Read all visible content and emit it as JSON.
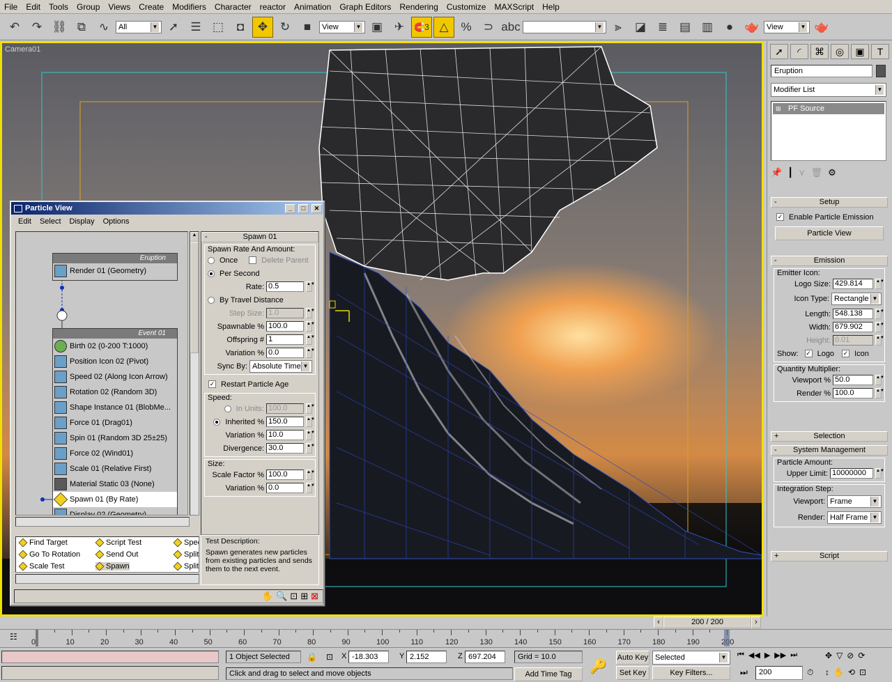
{
  "menubar": [
    "File",
    "Edit",
    "Tools",
    "Group",
    "Views",
    "Create",
    "Modifiers",
    "Character",
    "reactor",
    "Animation",
    "Graph Editors",
    "Rendering",
    "Customize",
    "MAXScript",
    "Help"
  ],
  "toolbar": {
    "selection_filter": "All",
    "ref_coord": "View",
    "named_sel": "",
    "view_dd2": "View",
    "snap_label": "3"
  },
  "viewport": {
    "label": "Camera01"
  },
  "particle_view": {
    "title": "Particle View",
    "menu": [
      "Edit",
      "Select",
      "Display",
      "Options"
    ],
    "eruption_event": {
      "title": "Eruption",
      "ops": [
        "Render 01 (Geometry)"
      ]
    },
    "event01": {
      "title": "Event 01",
      "ops": [
        "Birth 02 (0-200 T:1000)",
        "Position Icon 02 (Pivot)",
        "Speed 02 (Along Icon Arrow)",
        "Rotation 02 (Random 3D)",
        "Shape Instance 01 (BlobMe...",
        "Force 01 (Drag01)",
        "Spin 01 (Random 3D 25±25)",
        "Force 02 (Wind01)",
        "Scale 01 (Relative First)",
        "Material Static 03 (None)",
        "Spawn 01 (By Rate)",
        "Display 02 (Geometry)"
      ]
    },
    "params": {
      "rollout": "Spawn 01",
      "rate_group": "Spawn Rate And Amount:",
      "once": "Once",
      "delete_parent": "Delete Parent",
      "per_second": "Per Second",
      "rate_label": "Rate:",
      "rate": "0.5",
      "by_travel": "By Travel Distance",
      "step_label": "Step Size:",
      "step": "1.0",
      "spawnable_label": "Spawnable %",
      "spawnable": "100.0",
      "offspring_label": "Offspring #",
      "offspring": "1",
      "variation_label": "Variation %",
      "variation": "0.0",
      "sync_label": "Sync By:",
      "sync": "Absolute Time",
      "restart": "Restart Particle Age",
      "speed_group": "Speed:",
      "in_units_label": "In Units:",
      "in_units": "100.0",
      "inherited_label": "Inherited %",
      "inherited": "150.0",
      "speed_var_label": "Variation %",
      "speed_var": "10.0",
      "divergence_label": "Divergence:",
      "divergence": "30.0",
      "size_group": "Size:",
      "scale_label": "Scale Factor %",
      "scale": "100.0",
      "size_var_label": "Variation %",
      "size_var": "0.0"
    },
    "depot": [
      "Find Target",
      "Script Test",
      "Spee",
      "Go To Rotation",
      "Send Out",
      "Split",
      "Scale Test",
      "Spawn",
      "Split"
    ],
    "description": {
      "title": "Test Description:",
      "text": "Spawn generates new particles from existing particles and sends them to the next event."
    }
  },
  "command_panel": {
    "object_name": "Eruption",
    "modifier_list": "Modifier List",
    "stack_item": "PF Source",
    "setup": {
      "title": "Setup",
      "enable": "Enable Particle Emission",
      "pview_btn": "Particle View"
    },
    "emission": {
      "title": "Emission",
      "icon_group": "Emitter Icon:",
      "logo_label": "Logo Size:",
      "logo": "429.814",
      "type_label": "Icon Type:",
      "type": "Rectangle",
      "length_label": "Length:",
      "length": "548.138",
      "width_label": "Width:",
      "width": "679.902",
      "height_label": "Height:",
      "height": "0.01",
      "show_label": "Show:",
      "show_logo": "Logo",
      "show_icon": "Icon",
      "qm_group": "Quantity Multiplier:",
      "vp_label": "Viewport %",
      "vp": "50.0",
      "rd_label": "Render %",
      "rd": "100.0"
    },
    "selection": "Selection",
    "sysman": {
      "title": "System Management",
      "pa_group": "Particle Amount:",
      "ul_label": "Upper Limit:",
      "ul": "10000000",
      "is_group": "Integration Step:",
      "vp_label": "Viewport:",
      "vp": "Frame",
      "rd_label": "Render:",
      "rd": "Half Frame"
    },
    "script": "Script"
  },
  "timeline": {
    "frame": "200 / 200",
    "ticks": [
      "0",
      "10",
      "20",
      "30",
      "40",
      "50",
      "60",
      "70",
      "80",
      "90",
      "100",
      "110",
      "120",
      "130",
      "140",
      "150",
      "160",
      "170",
      "180",
      "190",
      "200"
    ]
  },
  "status": {
    "selected": "1 Object Selected",
    "prompt": "Click and drag to select and move objects",
    "x": "-18.303",
    "y": "2.152",
    "z": "697.204",
    "x_label": "X",
    "y_label": "Y",
    "z_label": "Z",
    "grid": "Grid = 10.0",
    "add_time_tag": "Add Time Tag",
    "auto_key": "Auto Key",
    "set_key": "Set Key",
    "key_mode": "Selected",
    "key_filters": "Key Filters...",
    "frame": "200"
  }
}
